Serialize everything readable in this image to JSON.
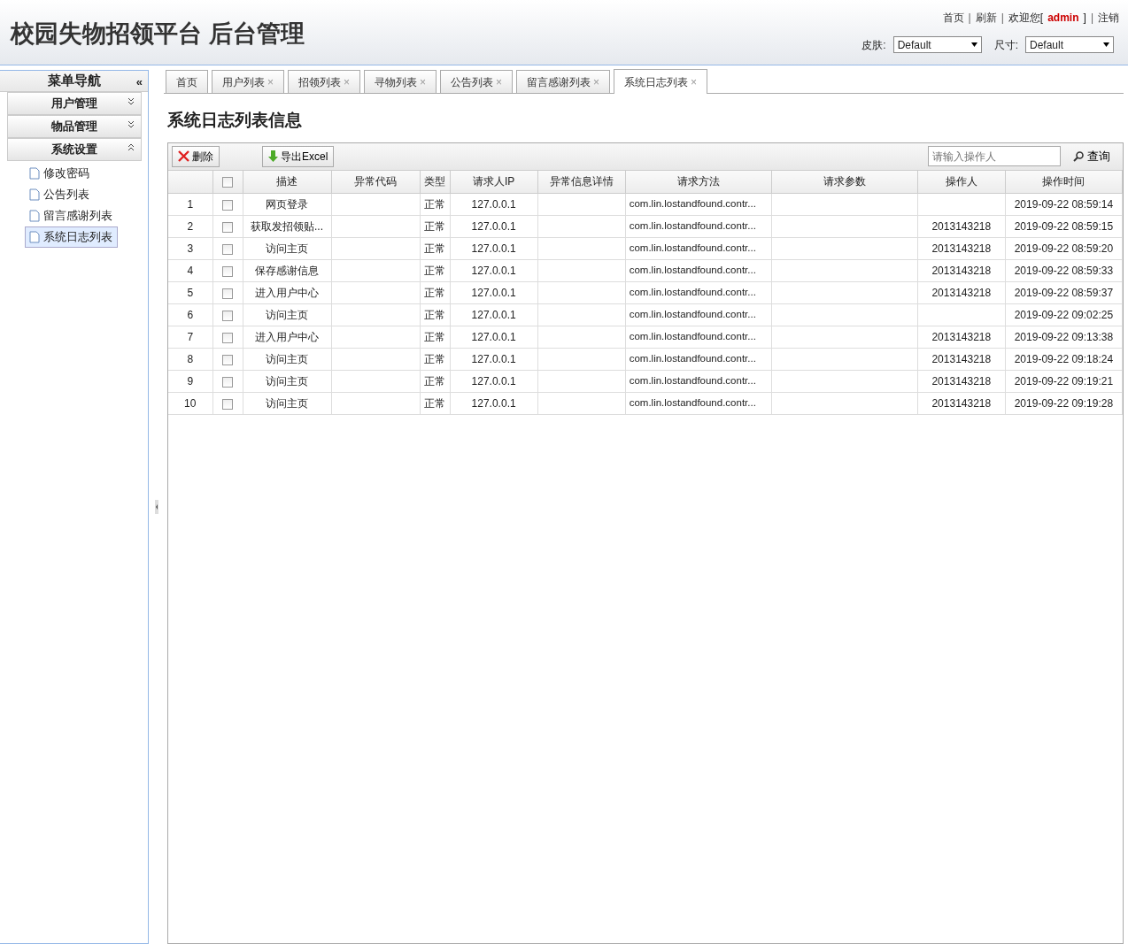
{
  "header": {
    "title": "校园失物招领平台 后台管理",
    "top_bar": [
      {
        "kind": "link",
        "text": "首页"
      },
      {
        "kind": "sep",
        "text": "|"
      },
      {
        "kind": "link",
        "text": "刷新"
      },
      {
        "kind": "sep",
        "text": "|"
      },
      {
        "kind": "text",
        "text": "欢迎您["
      },
      {
        "kind": "user",
        "text": "admin"
      },
      {
        "kind": "text",
        "text": "]"
      },
      {
        "kind": "sep",
        "text": "|"
      },
      {
        "kind": "link",
        "text": "注销"
      }
    ],
    "selects": [
      {
        "label": "皮肤:",
        "value": "Default"
      },
      {
        "label": "尺寸:",
        "value": "Default"
      }
    ]
  },
  "sidebar": {
    "title": "菜单导航",
    "collapse": "«",
    "groups": [
      {
        "label": "用户管理",
        "expanded": false
      },
      {
        "label": "物品管理",
        "expanded": false
      },
      {
        "label": "系统设置",
        "expanded": true,
        "children": [
          {
            "label": "修改密码",
            "selected": false
          },
          {
            "label": "公告列表",
            "selected": false
          },
          {
            "label": "留言感谢列表",
            "selected": false
          },
          {
            "label": "系统日志列表",
            "selected": true
          }
        ]
      }
    ]
  },
  "tabs": [
    {
      "label": "首页",
      "selected": false
    },
    {
      "label": "用户列表",
      "close": "×",
      "selected": false
    },
    {
      "label": "招领列表",
      "close": "×",
      "selected": false
    },
    {
      "label": "寻物列表",
      "close": "×",
      "selected": false
    },
    {
      "label": "公告列表",
      "close": "×",
      "selected": false
    },
    {
      "label": "留言感谢列表",
      "close": "×",
      "selected": false
    },
    {
      "label": "系统日志列表",
      "close": "×",
      "selected": true
    }
  ],
  "page_title": "系统日志列表信息",
  "toolbar": {
    "buttons": [
      {
        "kind": "delete",
        "label": "删除"
      },
      {
        "kind": "export",
        "label": "导出Excel"
      }
    ],
    "search": {
      "placeholder": "请输入操作人"
    },
    "search_button": "查询"
  },
  "table": {
    "select_all_checked": false,
    "columns": [
      "描述",
      "异常代码",
      "类型",
      "请求人IP",
      "异常信息详情",
      "请求方法",
      "请求参数",
      "操作人",
      "操作时间"
    ],
    "rows": [
      {
        "index": "1",
        "checked": false,
        "description": "网页登录",
        "type": "正常",
        "ip": "127.0.0.1",
        "method": "com.lin.lostandfound.contr...",
        "time": "2019-09-22 08:59:14"
      },
      {
        "index": "2",
        "checked": false,
        "description": "获取发招领贴...",
        "type": "正常",
        "ip": "127.0.0.1",
        "method": "com.lin.lostandfound.contr...",
        "operator": "2013143218",
        "time": "2019-09-22 08:59:15"
      },
      {
        "index": "3",
        "checked": false,
        "description": "访问主页",
        "type": "正常",
        "ip": "127.0.0.1",
        "method": "com.lin.lostandfound.contr...",
        "operator": "2013143218",
        "time": "2019-09-22 08:59:20"
      },
      {
        "index": "4",
        "checked": false,
        "description": "保存感谢信息",
        "type": "正常",
        "ip": "127.0.0.1",
        "method": "com.lin.lostandfound.contr...",
        "operator": "2013143218",
        "time": "2019-09-22 08:59:33"
      },
      {
        "index": "5",
        "checked": false,
        "description": "进入用户中心",
        "type": "正常",
        "ip": "127.0.0.1",
        "method": "com.lin.lostandfound.contr...",
        "operator": "2013143218",
        "time": "2019-09-22 08:59:37"
      },
      {
        "index": "6",
        "checked": false,
        "description": "访问主页",
        "type": "正常",
        "ip": "127.0.0.1",
        "method": "com.lin.lostandfound.contr...",
        "time": "2019-09-22 09:02:25"
      },
      {
        "index": "7",
        "checked": false,
        "description": "进入用户中心",
        "type": "正常",
        "ip": "127.0.0.1",
        "method": "com.lin.lostandfound.contr...",
        "operator": "2013143218",
        "time": "2019-09-22 09:13:38"
      },
      {
        "index": "8",
        "checked": false,
        "description": "访问主页",
        "type": "正常",
        "ip": "127.0.0.1",
        "method": "com.lin.lostandfound.contr...",
        "operator": "2013143218",
        "time": "2019-09-22 09:18:24"
      },
      {
        "index": "9",
        "checked": false,
        "description": "访问主页",
        "type": "正常",
        "ip": "127.0.0.1",
        "method": "com.lin.lostandfound.contr...",
        "operator": "2013143218",
        "time": "2019-09-22 09:19:21"
      },
      {
        "index": "10",
        "checked": false,
        "description": "访问主页",
        "type": "正常",
        "ip": "127.0.0.1",
        "method": "com.lin.lostandfound.contr...",
        "operator": "2013143218",
        "time": "2019-09-22 09:19:28"
      }
    ]
  }
}
